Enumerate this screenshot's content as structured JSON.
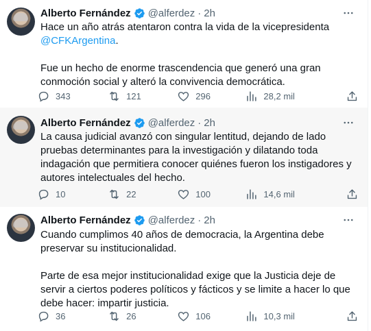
{
  "tweets": [
    {
      "author_name": "Alberto Fernández",
      "handle": "@alferdez",
      "separator": "·",
      "time": "2h",
      "text_line1": "Hace un año atrás atentaron contra la vida de la vicepresidenta",
      "mention": "@CFKArgentina",
      "mention_suffix": ".",
      "text_para2": "Fue un hecho de enorme trascendencia que generó una gran conmoción social y alteró la convivencia democrática.",
      "replies": "343",
      "retweets": "121",
      "likes": "296",
      "views": "28,2 mil"
    },
    {
      "author_name": "Alberto Fernández",
      "handle": "@alferdez",
      "separator": "·",
      "time": "2h",
      "text_para1": "La causa judicial avanzó con singular lentitud, dejando de lado pruebas determinantes para la investigación y dilatando toda indagación que permitiera conocer quiénes fueron los instigadores y autores intelectuales del hecho.",
      "replies": "10",
      "retweets": "22",
      "likes": "100",
      "views": "14,6 mil"
    },
    {
      "author_name": "Alberto Fernández",
      "handle": "@alferdez",
      "separator": "·",
      "time": "2h",
      "text_para1": "Cuando cumplimos 40 años de democracia, la Argentina debe preservar su institucionalidad.",
      "text_para2": "Parte de esa mejor institucionalidad exige que la Justicia deje de servir a ciertos poderes políticos y fácticos y se limite a hacer lo que debe hacer: impartir justicia.",
      "replies": "36",
      "retweets": "26",
      "likes": "106",
      "views": "10,3 mil"
    }
  ],
  "icons": {
    "verified": "verified-badge-icon",
    "more": "more-horizontal-icon",
    "reply": "reply-bubble-icon",
    "retweet": "retweet-icon",
    "like": "heart-icon",
    "views": "views-chart-icon",
    "share": "share-upload-icon"
  },
  "colors": {
    "text": "#0f1419",
    "secondary": "#536471",
    "link": "#1d9bf0",
    "verified": "#1d9bf0",
    "highlight_bg": "#f7f7f7"
  }
}
